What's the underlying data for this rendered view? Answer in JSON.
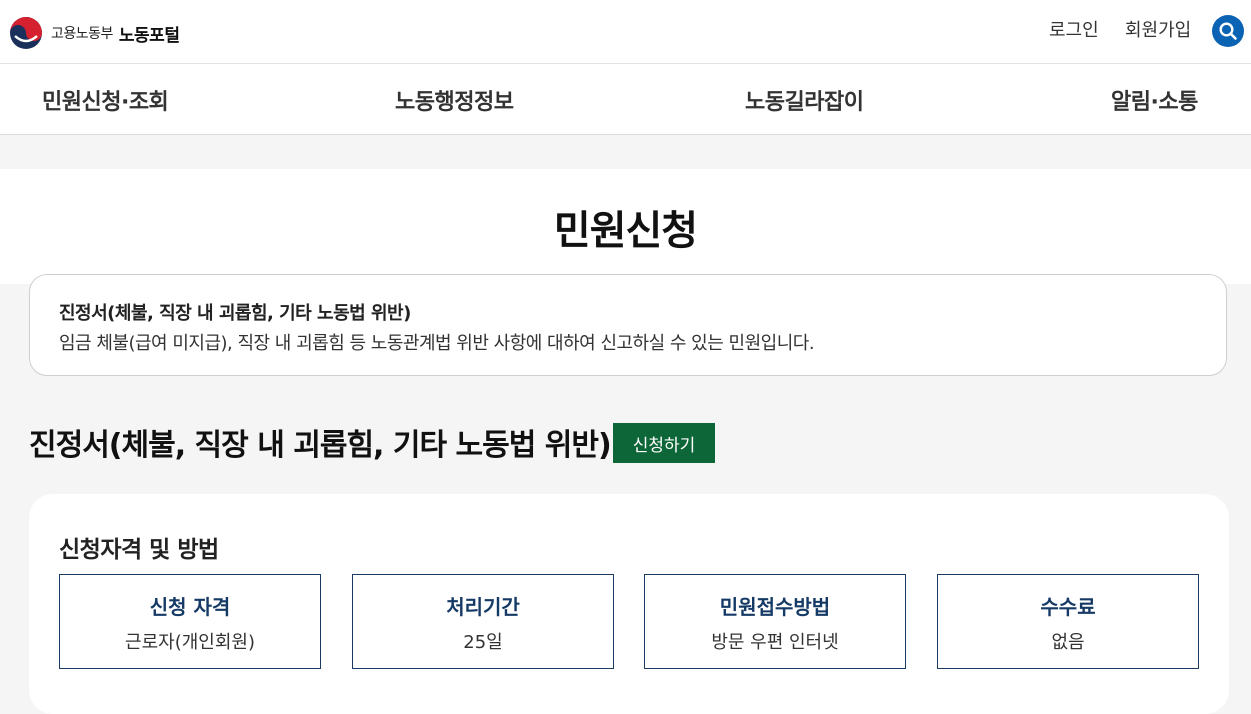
{
  "header": {
    "logo": {
      "ministry": "고용노동부",
      "portal": "노동포털"
    },
    "links": {
      "login": "로그인",
      "signup": "회원가입"
    },
    "search_icon": "search-icon",
    "accent_color": "#0a64b3"
  },
  "nav": {
    "items": [
      {
        "label": "민원신청·조회"
      },
      {
        "label": "노동행정정보"
      },
      {
        "label": "노동길라잡이"
      },
      {
        "label": "알림·소통"
      }
    ]
  },
  "page": {
    "title": "민원신청"
  },
  "intro": {
    "title": "진정서(체불, 직장 내 괴롭힘, 기타 노동법 위반)",
    "description": "임금 체불(급여 미지급), 직장 내 괴롭힘 등 노동관계법 위반 사항에 대하여 신고하실 수 있는 민원입니다."
  },
  "section": {
    "heading": "진정서(체불, 직장 내 괴롭힘, 기타 노동법 위반)",
    "apply_button": "신청하기",
    "apply_color": "#0d6637"
  },
  "qualification": {
    "title": "신청자격 및 방법",
    "boxes": [
      {
        "label": "신청 자격",
        "value": "근로자(개인회원)"
      },
      {
        "label": "처리기간",
        "value": "25일"
      },
      {
        "label": "민원접수방법",
        "value": "방문 우편 인터넷"
      },
      {
        "label": "수수료",
        "value": "없음"
      }
    ]
  }
}
